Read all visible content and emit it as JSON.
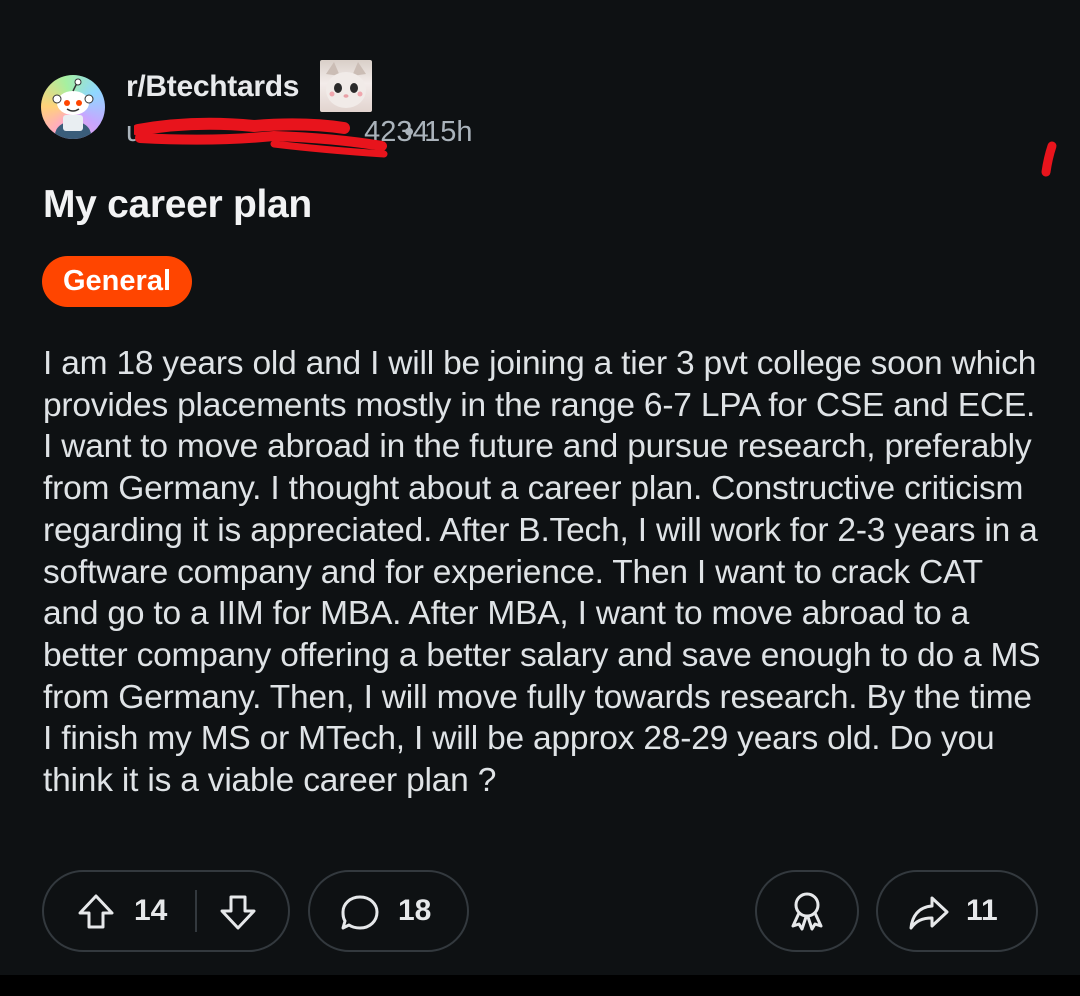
{
  "post": {
    "subreddit": "r/Btechtards",
    "author_visible": "u",
    "author_suffix": "4234",
    "separator": "•",
    "time": "15h",
    "title": "My career plan",
    "flair": "General",
    "body": "I am 18 years old and I will be joining a tier 3 pvt college soon which provides placements mostly in the range 6-7 LPA for CSE and ECE. I want to move abroad in the future and pursue research, preferably from Germany. I thought about a career plan. Constructive criticism regarding it is appreciated. After B.Tech, I will work for 2-3 years in a software company and for experience. Then I want to crack CAT and go to a IIM for MBA. After MBA, I want to move abroad to a better company offering a better salary and save enough to do a MS from Germany. Then, I will move fully towards research. By the time I finish my MS or MTech, I will be approx 28-29 years old. Do you think it is a viable career plan ?"
  },
  "actions": {
    "upvotes": "14",
    "comments": "18",
    "shares": "11"
  },
  "icons": {
    "avatar": "snoo-avatar-icon",
    "subreddit_image": "cat-photo-icon",
    "upvote": "arrow-up-icon",
    "downvote": "arrow-down-icon",
    "comment": "comment-bubble-icon",
    "award": "award-ribbon-icon",
    "share": "share-arrow-icon"
  },
  "colors": {
    "background": "#0e1113",
    "flair_bg": "#ff4500",
    "redaction": "#e8141c",
    "border": "#33393e"
  }
}
